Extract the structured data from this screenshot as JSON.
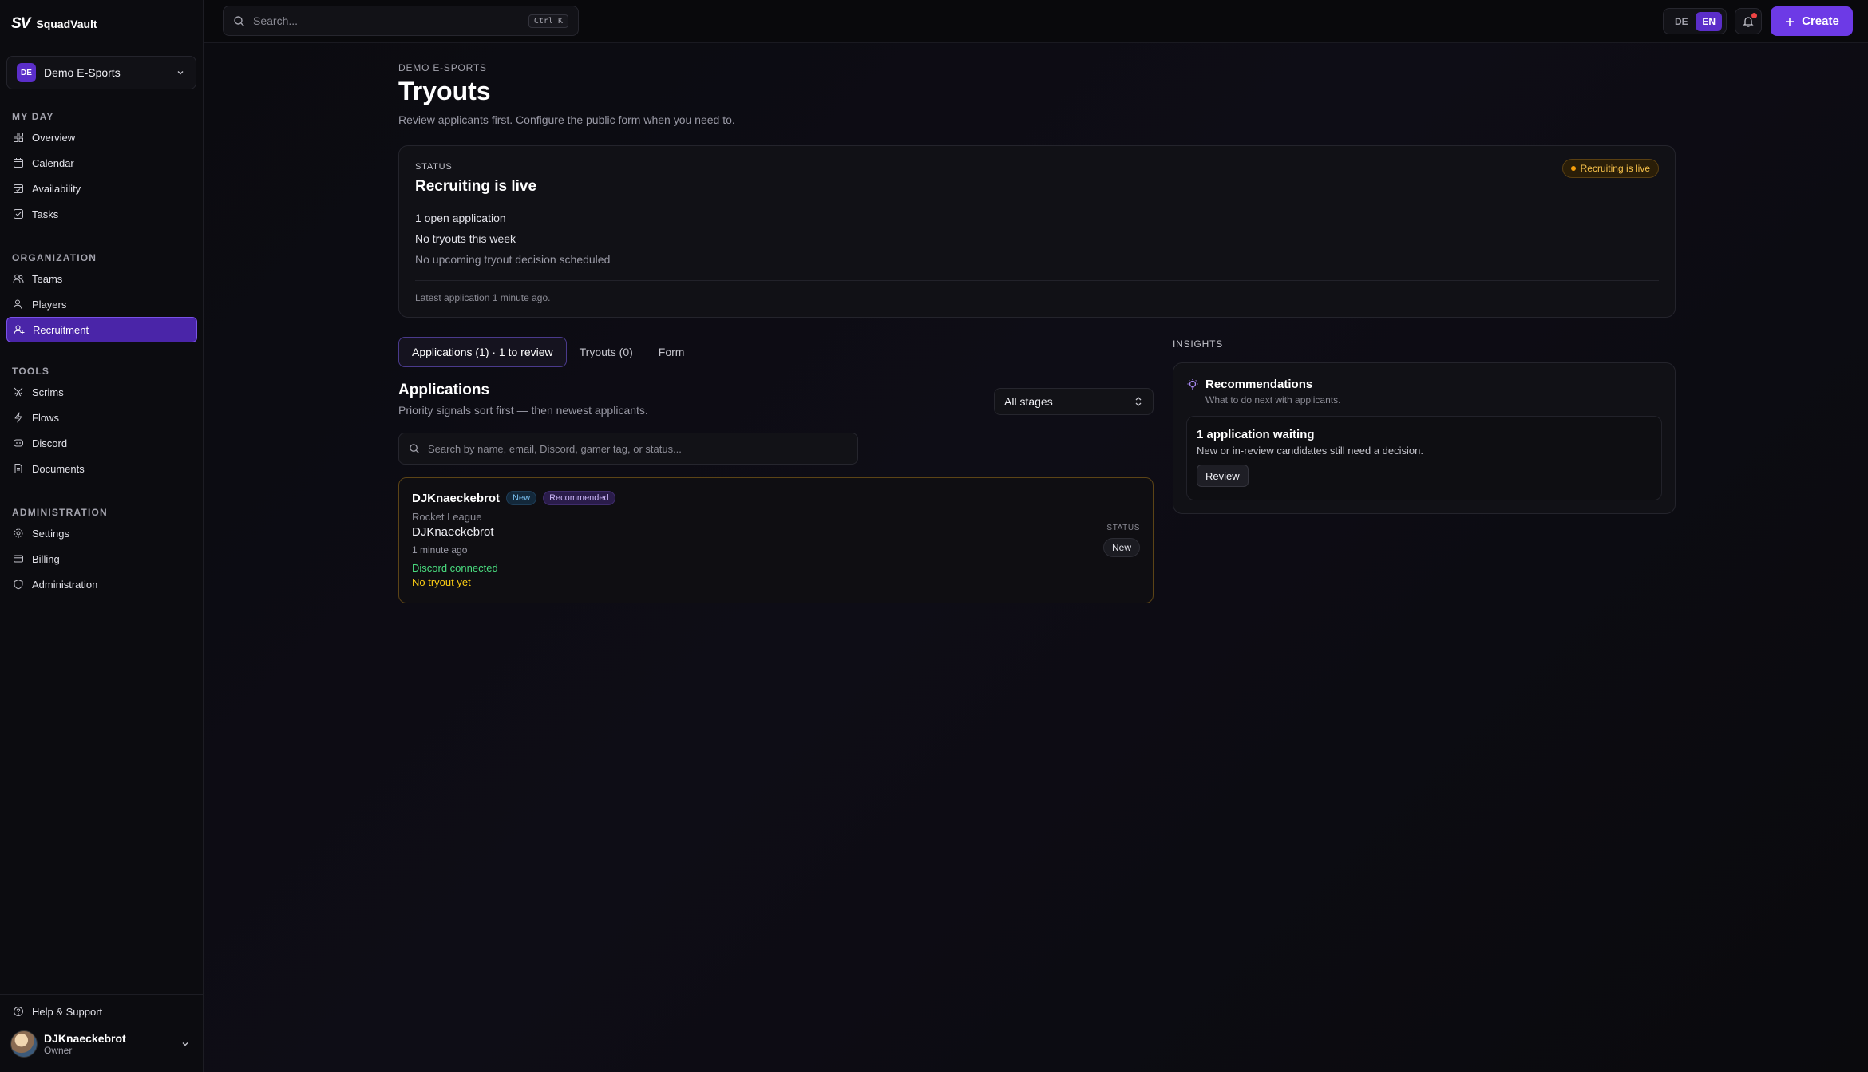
{
  "brand": {
    "logo": "SV",
    "name": "SquadVault"
  },
  "org_switcher": {
    "badge": "DE",
    "name": "Demo E-Sports"
  },
  "sidebar": {
    "sections": [
      {
        "title": "MY DAY",
        "items": [
          {
            "label": "Overview",
            "icon": "grid-icon"
          },
          {
            "label": "Calendar",
            "icon": "calendar-icon"
          },
          {
            "label": "Availability",
            "icon": "calendar-check-icon"
          },
          {
            "label": "Tasks",
            "icon": "checkbox-icon"
          }
        ]
      },
      {
        "title": "ORGANIZATION",
        "items": [
          {
            "label": "Teams",
            "icon": "users-icon"
          },
          {
            "label": "Players",
            "icon": "user-icon"
          },
          {
            "label": "Recruitment",
            "icon": "user-plus-icon",
            "active": true
          }
        ]
      },
      {
        "title": "TOOLS",
        "items": [
          {
            "label": "Scrims",
            "icon": "swords-icon"
          },
          {
            "label": "Flows",
            "icon": "zap-icon"
          },
          {
            "label": "Discord",
            "icon": "discord-icon"
          },
          {
            "label": "Documents",
            "icon": "document-icon"
          }
        ]
      },
      {
        "title": "ADMINISTRATION",
        "items": [
          {
            "label": "Settings",
            "icon": "gear-icon"
          },
          {
            "label": "Billing",
            "icon": "credit-card-icon"
          },
          {
            "label": "Administration",
            "icon": "shield-icon"
          }
        ]
      }
    ],
    "help": "Help & Support",
    "user": {
      "name": "DJKnaeckebrot",
      "role": "Owner"
    }
  },
  "topbar": {
    "search_placeholder": "Search...",
    "shortcut": "Ctrl K",
    "lang_de": "DE",
    "lang_en": "EN",
    "create_label": "Create"
  },
  "page": {
    "eyebrow": "DEMO E-SPORTS",
    "title": "Tryouts",
    "subtitle": "Review applicants first. Configure the public form when you need to."
  },
  "status_card": {
    "label": "STATUS",
    "title": "Recruiting is live",
    "pill": "Recruiting is live",
    "lines": [
      "1 open application",
      "No tryouts this week",
      "No upcoming tryout decision scheduled"
    ],
    "footer": "Latest application 1 minute ago."
  },
  "tabs": [
    "Applications (1) · 1 to review",
    "Tryouts (0)",
    "Form"
  ],
  "applications": {
    "title": "Applications",
    "subtitle": "Priority signals sort first — then newest applicants.",
    "stage_select": "All stages",
    "search_placeholder": "Search by name, email, Discord, gamer tag, or status...",
    "items": [
      {
        "name": "DJKnaeckebrot",
        "badge_new": "New",
        "badge_recommended": "Recommended",
        "game": "Rocket League",
        "handle": "DJKnaeckebrot",
        "time": "1 minute ago",
        "discord": "Discord connected",
        "tryout": "No tryout yet",
        "status_label": "STATUS",
        "status": "New"
      }
    ]
  },
  "insights": {
    "label": "INSIGHTS",
    "title": "Recommendations",
    "subtitle": "What to do next with applicants.",
    "item": {
      "title": "1 application waiting",
      "subtitle": "New or in-review candidates still need a decision.",
      "button": "Review"
    }
  },
  "colors": {
    "accent": "#6d3ae6",
    "live": "#f59e0b",
    "discord_ok": "#4ade80",
    "tryout_warn": "#facc15"
  }
}
